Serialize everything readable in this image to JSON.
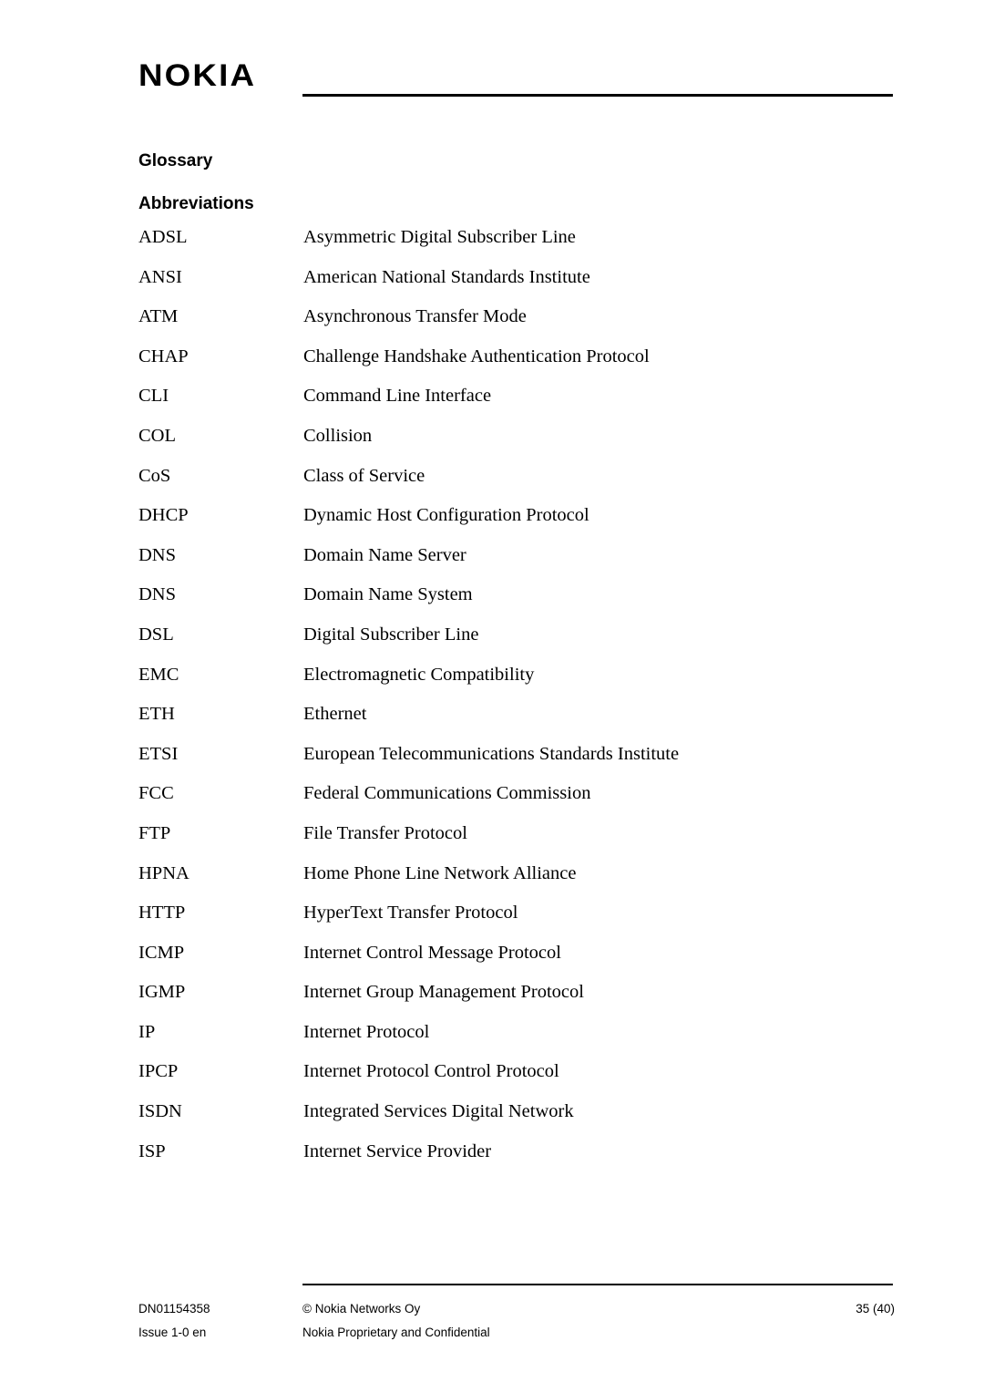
{
  "header": {
    "logo_text": "NOKIA"
  },
  "titles": {
    "glossary": "Glossary",
    "abbreviations": "Abbreviations"
  },
  "glossary": [
    {
      "term": "ADSL",
      "definition": "Asymmetric Digital Subscriber Line"
    },
    {
      "term": "ANSI",
      "definition": "American National Standards Institute"
    },
    {
      "term": "ATM",
      "definition": "Asynchronous Transfer Mode"
    },
    {
      "term": "CHAP",
      "definition": "Challenge Handshake Authentication Protocol"
    },
    {
      "term": "CLI",
      "definition": "Command Line Interface"
    },
    {
      "term": "COL",
      "definition": "Collision"
    },
    {
      "term": "CoS",
      "definition": "Class of Service"
    },
    {
      "term": "DHCP",
      "definition": "Dynamic Host Configuration Protocol"
    },
    {
      "term": "DNS",
      "definition": "Domain Name Server"
    },
    {
      "term": "DNS",
      "definition": "Domain Name System"
    },
    {
      "term": "DSL",
      "definition": "Digital Subscriber Line"
    },
    {
      "term": "EMC",
      "definition": "Electromagnetic Compatibility"
    },
    {
      "term": "ETH",
      "definition": "Ethernet"
    },
    {
      "term": "ETSI",
      "definition": "European Telecommunications Standards Institute"
    },
    {
      "term": "FCC",
      "definition": "Federal Communications Commission"
    },
    {
      "term": "FTP",
      "definition": "File Transfer Protocol"
    },
    {
      "term": "HPNA",
      "definition": "Home Phone Line Network Alliance"
    },
    {
      "term": "HTTP",
      "definition": "HyperText Transfer Protocol"
    },
    {
      "term": "ICMP",
      "definition": "Internet Control Message Protocol"
    },
    {
      "term": "IGMP",
      "definition": "Internet Group Management Protocol"
    },
    {
      "term": "IP",
      "definition": "Internet Protocol"
    },
    {
      "term": "IPCP",
      "definition": "Internet Protocol Control Protocol"
    },
    {
      "term": "ISDN",
      "definition": "Integrated Services Digital Network"
    },
    {
      "term": "ISP",
      "definition": "Internet Service Provider"
    }
  ],
  "footer": {
    "doc_id": "DN01154358",
    "copyright": "© Nokia Networks Oy",
    "page": "35 (40)",
    "issue": "Issue 1-0 en",
    "confidentiality": "Nokia Proprietary and Confidential"
  }
}
